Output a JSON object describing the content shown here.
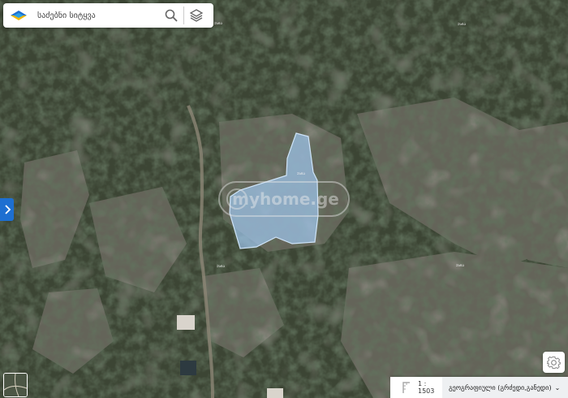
{
  "search": {
    "placeholder": "საძებნი სიტყვა"
  },
  "scale": {
    "text": "1 : 1503"
  },
  "basemap": {
    "label": "გეოგრაფიული (გრძედი,განედი)"
  },
  "watermark": "myhome.ge",
  "map_labels": [
    "ᲔᲡᲜᲐ",
    "ᲔᲡᲜᲐ",
    "ᲔᲡᲜᲐ",
    "ᲔᲡᲜᲐ",
    "ᲔᲡᲜᲐ"
  ],
  "colors": {
    "brand_blue": "#1d6fd1",
    "parcel_fill": "#9fc7ef",
    "parcel_stroke": "#cfe4f8"
  },
  "icons": [
    "app-logo-icon",
    "search-icon",
    "layers-icon",
    "chevron-right-icon",
    "gear-icon",
    "ruler-icon",
    "chevron-down-icon"
  ]
}
